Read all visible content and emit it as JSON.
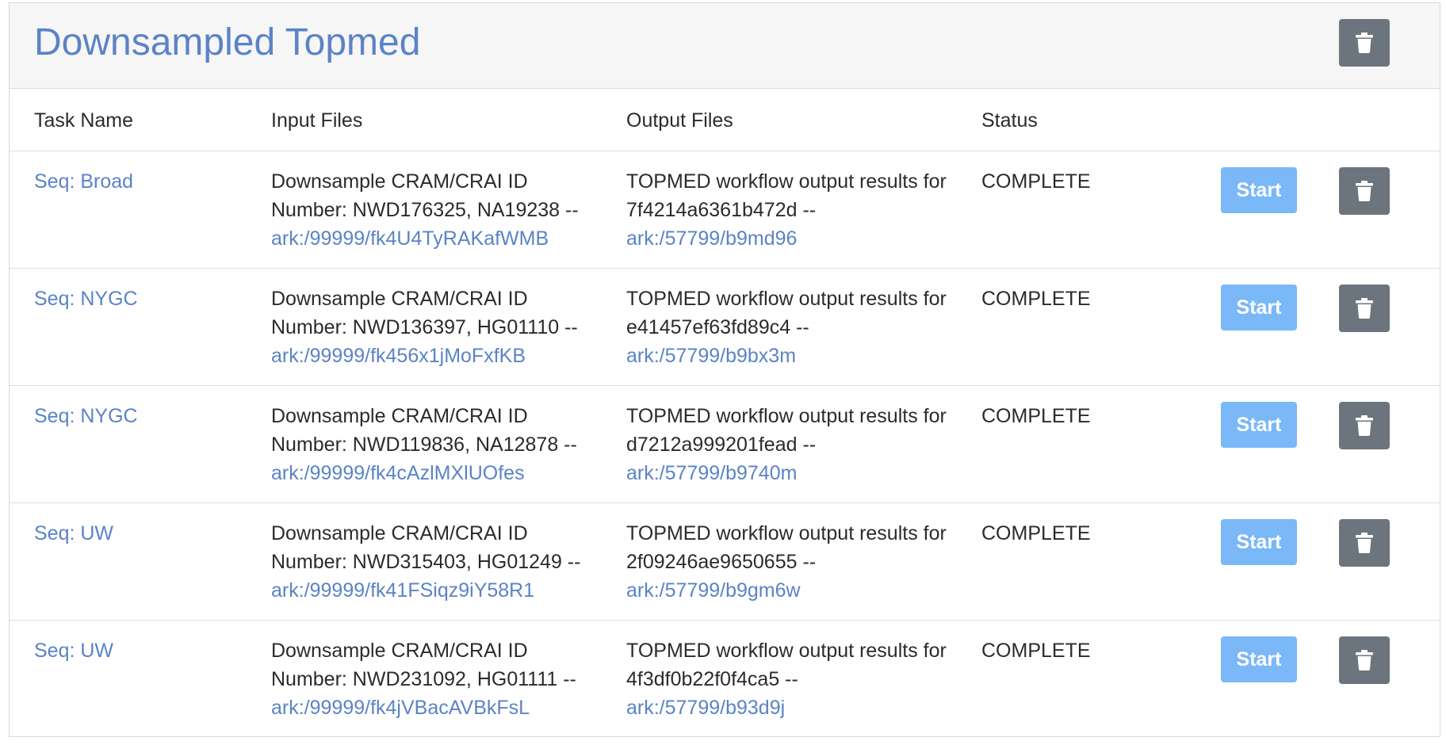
{
  "card": {
    "title": "Downsampled Topmed",
    "delete_icon": "trash-icon"
  },
  "table": {
    "headers": [
      "Task Name",
      "Input Files",
      "Output Files",
      "Status"
    ],
    "start_label": "Start",
    "rows": [
      {
        "task": "Seq: Broad",
        "input_line1": "Downsample CRAM/CRAI ID",
        "input_line2": "Number: NWD176325, NA19238 --",
        "input_link": "ark:/99999/fk4U4TyRAKafWMB",
        "output_line1": "TOPMED workflow output results for",
        "output_line2": "7f4214a6361b472d --",
        "output_link": "ark:/57799/b9md96",
        "status": "COMPLETE"
      },
      {
        "task": "Seq: NYGC",
        "input_line1": "Downsample CRAM/CRAI ID",
        "input_line2": "Number: NWD136397, HG01110 --",
        "input_link": "ark:/99999/fk456x1jMoFxfKB",
        "output_line1": "TOPMED workflow output results for",
        "output_line2": "e41457ef63fd89c4 --",
        "output_link": "ark:/57799/b9bx3m",
        "status": "COMPLETE"
      },
      {
        "task": "Seq: NYGC",
        "input_line1": "Downsample CRAM/CRAI ID",
        "input_line2": "Number: NWD119836, NA12878 --",
        "input_link": "ark:/99999/fk4cAzlMXlUOfes",
        "output_line1": "TOPMED workflow output results for",
        "output_line2": "d7212a999201fead --",
        "output_link": "ark:/57799/b9740m",
        "status": "COMPLETE"
      },
      {
        "task": "Seq: UW",
        "input_line1": "Downsample CRAM/CRAI ID",
        "input_line2": "Number: NWD315403, HG01249 --",
        "input_link": "ark:/99999/fk41FSiqz9iY58R1",
        "output_line1": "TOPMED workflow output results for",
        "output_line2": "2f09246ae9650655 --",
        "output_link": "ark:/57799/b9gm6w",
        "status": "COMPLETE"
      },
      {
        "task": "Seq: UW",
        "input_line1": "Downsample CRAM/CRAI ID",
        "input_line2": "Number: NWD231092, HG01111 --",
        "input_link": "ark:/99999/fk4jVBacAVBkFsL",
        "output_line1": "TOPMED workflow output results for",
        "output_line2": "4f3df0b22f0f4ca5 --",
        "output_link": "ark:/57799/b93d9j",
        "status": "COMPLETE"
      }
    ]
  },
  "colors": {
    "link": "#5b83c6",
    "start_button": "#7ab8f7",
    "delete_button": "#6c757d",
    "header_background": "#f6f6f6"
  }
}
